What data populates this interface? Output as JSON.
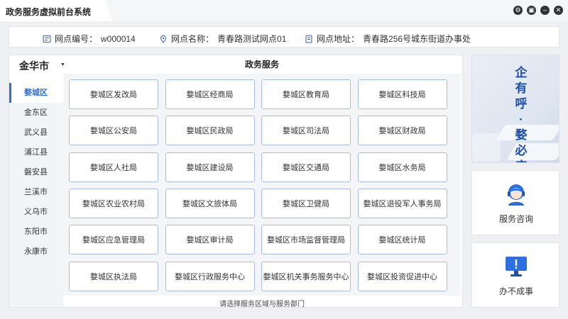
{
  "window": {
    "title": "政务服务虚拟前台系统",
    "controls": [
      "settings-icon",
      "screen-icon",
      "minimize-icon",
      "close-icon"
    ]
  },
  "info": {
    "number_label": "网点编号：",
    "number_value": "w000014",
    "name_label": "网点名称：",
    "name_value": "青春路测试网点01",
    "address_label": "网点地址：",
    "address_value": "青春路256号城东街道办事处"
  },
  "city": {
    "name": "金华市"
  },
  "districts": [
    "婺城区",
    "金东区",
    "武义县",
    "浦江县",
    "磐安县",
    "兰溪市",
    "义乌市",
    "东阳市",
    "永康市"
  ],
  "active_district": "婺城区",
  "section_title": "政务服务",
  "services": [
    "婺城区发改局",
    "婺城区经商局",
    "婺城区教育局",
    "婺城区科技局",
    "婺城区公安局",
    "婺城区民政局",
    "婺城区司法局",
    "婺城区财政局",
    "婺城区人社局",
    "婺城区建设局",
    "婺城区交通局",
    "婺城区水务局",
    "婺城区农业农村局",
    "婺城区文旅体局",
    "婺城区卫健局",
    "婺城区退役军人事务局",
    "婺城区应急管理局",
    "婺城区审计局",
    "婺城区市场监督管理局",
    "婺城区统计局",
    "婺城区执法局",
    "婺城区行政服务中心",
    "婺城区机关事务服务中心",
    "婺城区投资促进中心"
  ],
  "hint": "请选择服务区域与服务部门",
  "banner": {
    "text": "企有呼·婺必应"
  },
  "consult": {
    "label": "服务咨询",
    "icon": "service-agent-icon"
  },
  "unresolved": {
    "label": "办不成事",
    "icon": "warning-monitor-icon"
  },
  "colors": {
    "accent": "#2b6fe0",
    "banner_text": "#1d4fa8",
    "button_border": "#a8bde0"
  }
}
